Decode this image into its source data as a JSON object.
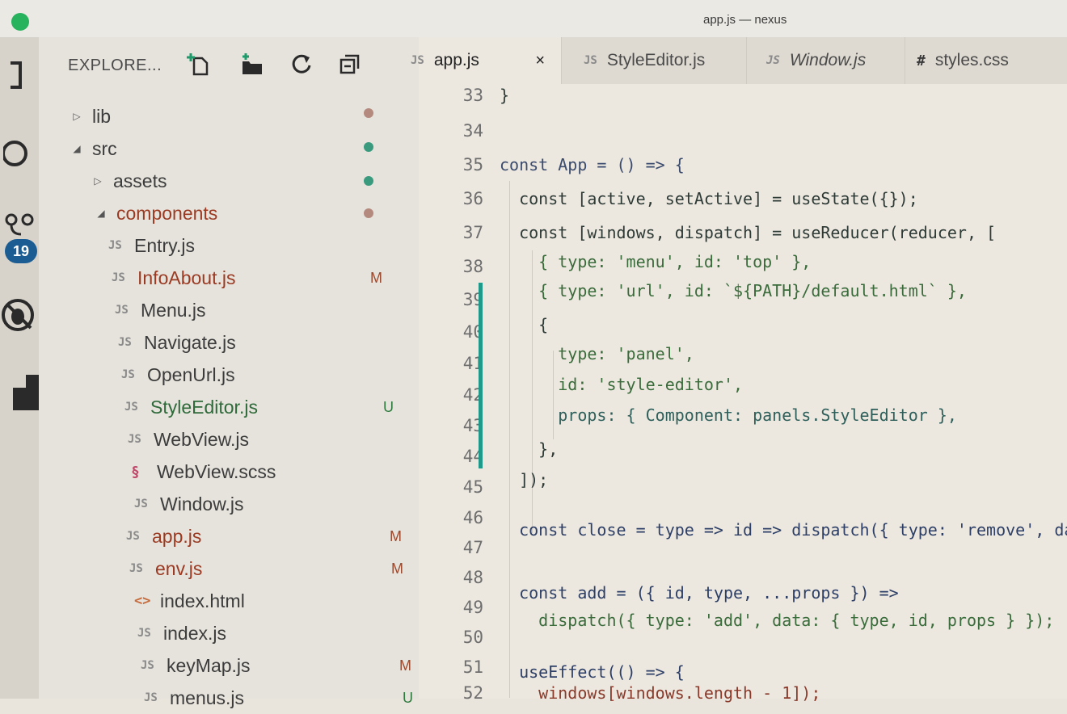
{
  "window": {
    "title": "app.js — nexus"
  },
  "activity_bar": {
    "icons": [
      "files-icon",
      "search-icon",
      "source-control-icon",
      "debug-icon",
      "extensions-icon"
    ],
    "scm_badge": "19"
  },
  "sidebar": {
    "title": "EXPLORE...",
    "actions": [
      "new-file-icon",
      "new-folder-icon",
      "refresh-icon",
      "collapse-all-icon"
    ],
    "tree": [
      {
        "name": "lib",
        "type": "folder",
        "collapsed": true,
        "indent": 0,
        "dot": "#b58a7e"
      },
      {
        "name": "src",
        "type": "folder",
        "collapsed": false,
        "indent": 0,
        "dot": "#3a9a7e"
      },
      {
        "name": "assets",
        "type": "folder",
        "collapsed": true,
        "indent": 1,
        "dot": "#3a9a7e"
      },
      {
        "name": "components",
        "type": "folder",
        "collapsed": false,
        "indent": 1,
        "dot": "#b58a7e",
        "status": "modified"
      },
      {
        "name": "Entry.js",
        "icon": "JS",
        "indent": 2
      },
      {
        "name": "InfoAbout.js",
        "icon": "JS",
        "indent": 2,
        "git": "M",
        "status": "modified"
      },
      {
        "name": "Menu.js",
        "icon": "JS",
        "indent": 2
      },
      {
        "name": "Navigate.js",
        "icon": "JS",
        "indent": 2
      },
      {
        "name": "OpenUrl.js",
        "icon": "JS",
        "indent": 2
      },
      {
        "name": "StyleEditor.js",
        "icon": "JS",
        "indent": 2,
        "git": "U",
        "status": "untracked"
      },
      {
        "name": "WebView.js",
        "icon": "JS",
        "indent": 2
      },
      {
        "name": "WebView.scss",
        "icon": "scss",
        "indent": 2
      },
      {
        "name": "Window.js",
        "icon": "JS",
        "indent": 2
      },
      {
        "name": "app.js",
        "icon": "JS",
        "indent": 1,
        "git": "M",
        "status": "modified"
      },
      {
        "name": "env.js",
        "icon": "JS",
        "indent": 1,
        "git": "M",
        "status": "modified"
      },
      {
        "name": "index.html",
        "icon": "html",
        "indent": 1
      },
      {
        "name": "index.js",
        "icon": "JS",
        "indent": 1
      },
      {
        "name": "keyMap.js",
        "icon": "JS",
        "indent": 1,
        "git": "M"
      },
      {
        "name": "menus.js",
        "icon": "JS",
        "indent": 1,
        "git": "U"
      }
    ]
  },
  "tabs": [
    {
      "label": "app.js",
      "icon": "JS",
      "active": true,
      "close": "×"
    },
    {
      "label": "StyleEditor.js",
      "icon": "JS"
    },
    {
      "label": "Window.js",
      "icon": "JS",
      "italic": true
    },
    {
      "label": "styles.css",
      "icon": "#"
    }
  ],
  "editor": {
    "lines": [
      {
        "n": "33",
        "code": "}"
      },
      {
        "n": "34",
        "code": ""
      },
      {
        "n": "35",
        "code": "const App = () => {"
      },
      {
        "n": "36",
        "code": "  const [active, setActive] = useState({});"
      },
      {
        "n": "37",
        "code": "  const [windows, dispatch] = useReducer(reducer, ["
      },
      {
        "n": "38",
        "code": "    { type: 'menu', id: 'top' },"
      },
      {
        "n": "39",
        "code": "    { type: 'url', id: `${PATH}/default.html` },"
      },
      {
        "n": "40",
        "code": "    {"
      },
      {
        "n": "41",
        "code": "      type: 'panel',"
      },
      {
        "n": "42",
        "code": "      id: 'style-editor',"
      },
      {
        "n": "43",
        "code": "      props: { Component: panels.StyleEditor },"
      },
      {
        "n": "44",
        "code": "    },"
      },
      {
        "n": "45",
        "code": "  ]);"
      },
      {
        "n": "46",
        "code": ""
      },
      {
        "n": "47",
        "code": "  const close = type => id => dispatch({ type: 'remove', data:"
      },
      {
        "n": "48",
        "code": ""
      },
      {
        "n": "49",
        "code": "  const add = ({ id, type, ...props }) =>"
      },
      {
        "n": "50",
        "code": "    dispatch({ type: 'add', data: { type, id, props } });"
      },
      {
        "n": "51",
        "code": ""
      },
      {
        "n": "52",
        "code": "  useEffect(() => {"
      }
    ],
    "last_visible": "    windows[windows.length - 1]);"
  }
}
